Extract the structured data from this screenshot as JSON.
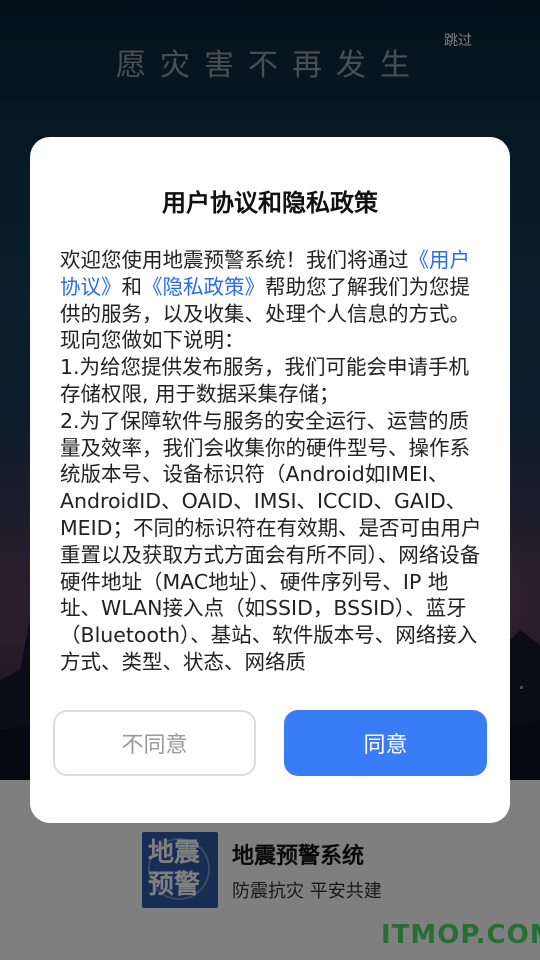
{
  "splash": {
    "slogan": "愿灾害不再发生",
    "skip_label": "跳过"
  },
  "brand": {
    "logo_line1": "地震",
    "logo_line2": "预警",
    "app_name": "地震预警系统",
    "app_slogan": "防震抗灾 平安共建",
    "watermark": "ITMOP.COM"
  },
  "dialog": {
    "title": "用户协议和隐私政策",
    "intro_before": "欢迎您使用地震预警系统！我们将通过",
    "user_agreement_link": "《用户协议》",
    "and": "和",
    "privacy_link": "《隐私政策》",
    "intro_after": "帮助您了解我们为您提供的服务，以及收集、处理个人信息的方式。现向您做如下说明：",
    "item1": "1.为给您提供发布服务，我们可能会申请手机存储权限, 用于数据采集存储；",
    "item2": "2.为了保障软件与服务的安全运行、运营的质量及效率，我们会收集你的硬件型号、操作系统版本号、设备标识符（Android如IMEI、AndroidID、OAID、IMSI、ICCID、GAID、MEID；不同的标识符在有效期、是否可由用户重置以及获取方式方面会有所不同）、网络设备硬件地址（MAC地址）、硬件序列号、IP 地址、WLAN接入点（如SSID，BSSID）、蓝牙（Bluetooth）、基站、软件版本号、网络接入方式、类型、状态、网络质",
    "disagree_label": "不同意",
    "agree_label": "同意"
  },
  "colors": {
    "link": "#2a6cf0",
    "agree_button": "#3a7cf5",
    "logo_bg": "#2e5aa7",
    "watermark": "#4ddc6a"
  }
}
